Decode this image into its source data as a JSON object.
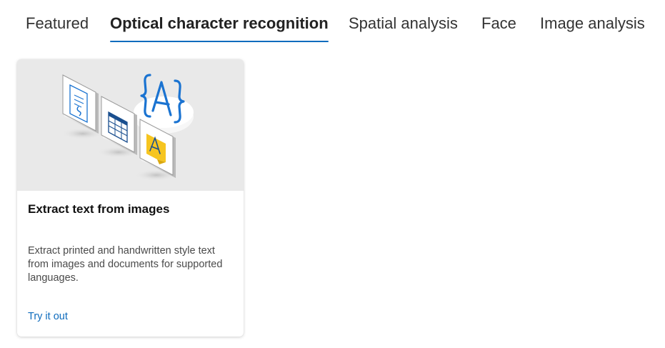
{
  "tabs": [
    {
      "label": "Featured",
      "active": false
    },
    {
      "label": "Optical character recognition",
      "active": true
    },
    {
      "label": "Spatial analysis",
      "active": false
    },
    {
      "label": "Face",
      "active": false
    },
    {
      "label": "Image analysis",
      "active": false
    }
  ],
  "card": {
    "illustration": "ocr-documents-illustration",
    "title": "Extract text from images",
    "description": "Extract printed and handwritten style text from images and documents for supported languages.",
    "link_label": "Try it out"
  },
  "colors": {
    "accent": "#0f6cbd",
    "hero_background": "#e9e9e9",
    "glyph_blue": "#1a73d1",
    "sticky_yellow": "#f6c520"
  }
}
